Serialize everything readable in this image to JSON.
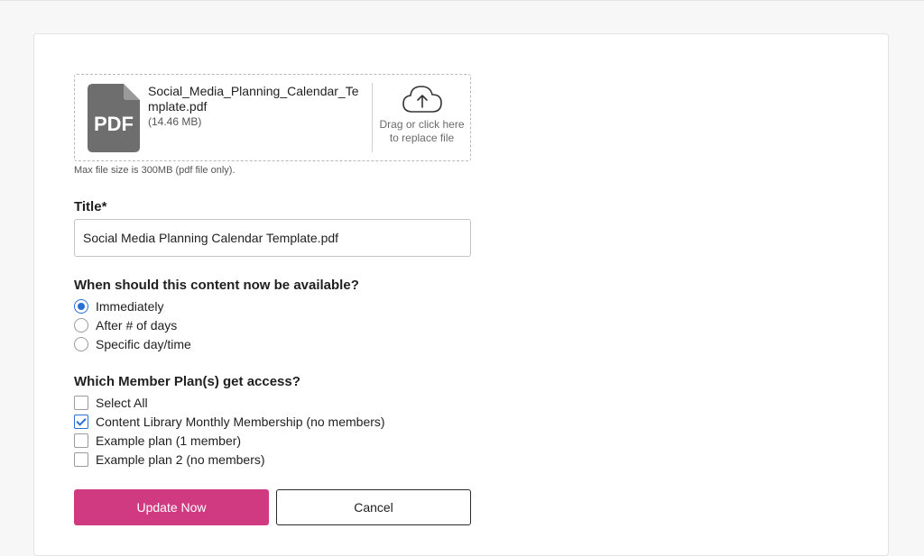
{
  "file": {
    "name": "Social_Media_Planning_Calendar_Template.pdf",
    "size": "(14.46 MB)",
    "icon": "pdf-file-icon",
    "icon_text": "PDF",
    "replace_hint": "Drag or click here to replace file",
    "max_note": "Max file size is 300MB (pdf file only)."
  },
  "title_field": {
    "label": "Title*",
    "value": "Social Media Planning Calendar Template.pdf"
  },
  "availability": {
    "label": "When should this content now be available?",
    "options": [
      {
        "label": "Immediately",
        "checked": true
      },
      {
        "label": "After # of days",
        "checked": false
      },
      {
        "label": "Specific day/time",
        "checked": false
      }
    ]
  },
  "plans": {
    "label": "Which Member Plan(s) get access?",
    "options": [
      {
        "label": "Select All",
        "checked": false
      },
      {
        "label": "Content Library Monthly Membership (no members)",
        "checked": true
      },
      {
        "label": "Example plan (1 member)",
        "checked": false
      },
      {
        "label": "Example plan 2 (no members)",
        "checked": false
      }
    ]
  },
  "actions": {
    "update_label": "Update Now",
    "cancel_label": "Cancel"
  },
  "colors": {
    "primary": "#cf3a80",
    "accent": "#2a6fd6"
  }
}
